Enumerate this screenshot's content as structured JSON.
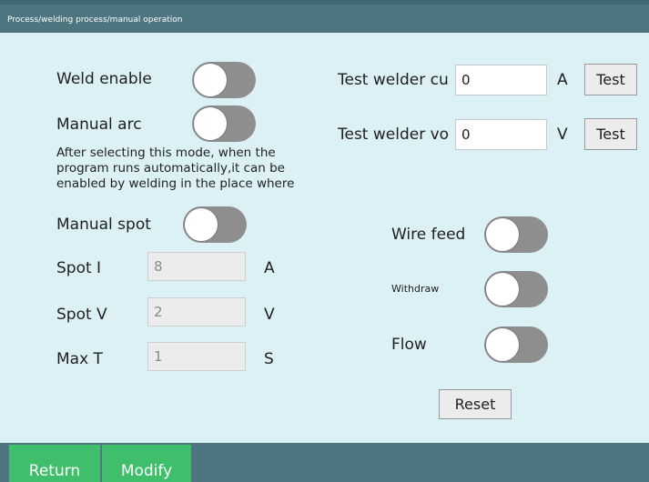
{
  "header": {
    "breadcrumb": "Process/welding process/manual operation"
  },
  "left": {
    "weld_enable_label": "Weld enable",
    "weld_enable_on": false,
    "manual_arc_label": "Manual arc",
    "manual_arc_on": false,
    "manual_arc_note": "After selecting this mode, when the program runs automatically,it can be enabled by welding in the place where",
    "manual_spot_label": "Manual spot",
    "manual_spot_on": false,
    "spot_i": {
      "label": "Spot I",
      "value": "8",
      "unit": "A"
    },
    "spot_v": {
      "label": "Spot V",
      "value": "2",
      "unit": "V"
    },
    "max_t": {
      "label": "Max T",
      "value": "1",
      "unit": "S"
    }
  },
  "right": {
    "test_current": {
      "label": "Test welder cu",
      "value": "0",
      "unit": "A",
      "button": "Test"
    },
    "test_voltage": {
      "label": "Test welder vo",
      "value": "0",
      "unit": "V",
      "button": "Test"
    },
    "wire_feed_label": "Wire feed",
    "wire_feed_on": false,
    "withdraw_label": "Withdraw",
    "withdraw_on": false,
    "flow_label": "Flow",
    "flow_on": false,
    "reset_button": "Reset"
  },
  "footer": {
    "return_button": "Return",
    "modify_button": "Modify"
  },
  "colors": {
    "background": "#dcf1f6",
    "bar": "#4d7680",
    "nav_button": "#3fbf6b",
    "toggle_off": "#8e8e8e"
  }
}
